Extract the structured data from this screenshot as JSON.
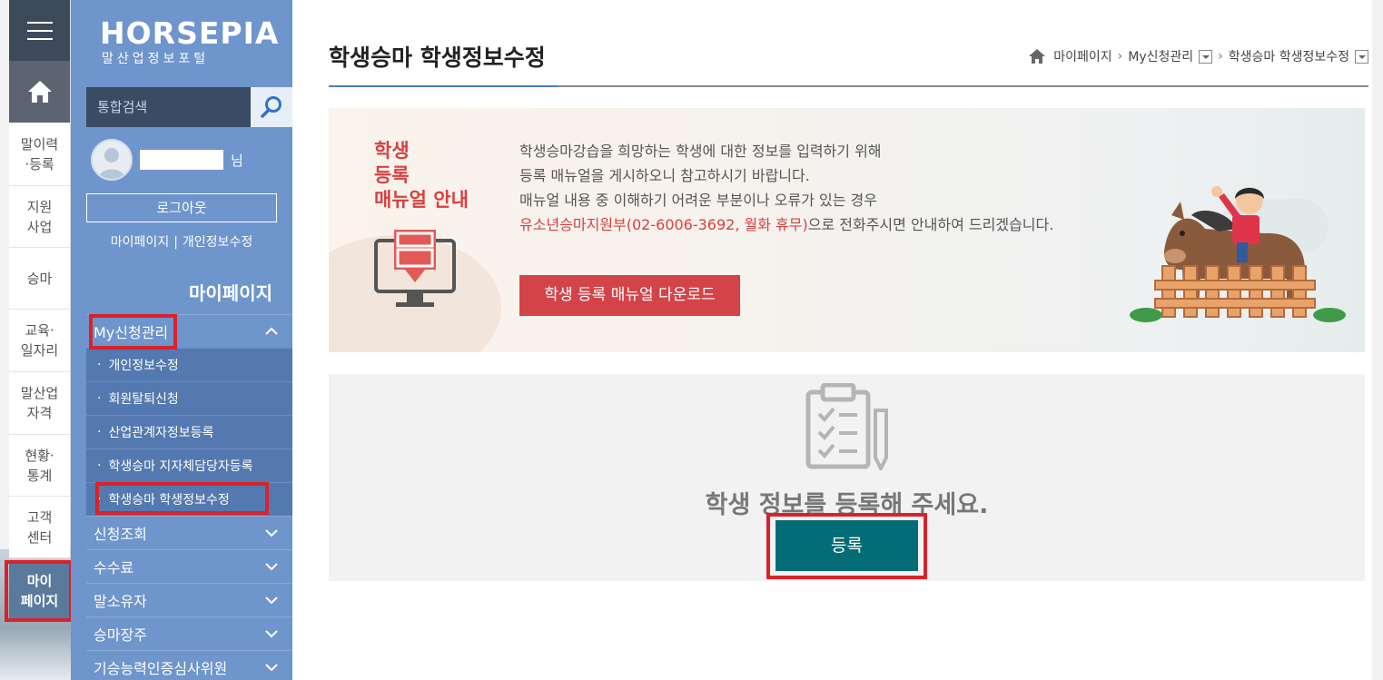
{
  "rail": {
    "items": [
      {
        "label": "말이력\n·등록"
      },
      {
        "label": "지원\n사업"
      },
      {
        "label": "승마"
      },
      {
        "label": "교육·\n일자리"
      },
      {
        "label": "말산업\n자격"
      },
      {
        "label": "현황·\n통계"
      },
      {
        "label": "고객\n센터"
      },
      {
        "label": "마이\n페이지"
      }
    ]
  },
  "brand": {
    "main": "HORSEPIA",
    "sub": "말산업정보포털"
  },
  "search": {
    "placeholder": "통합검색"
  },
  "user": {
    "suffix": "님"
  },
  "sidebar": {
    "logout": "로그아웃",
    "quick_links": [
      "마이페이지",
      "개인정보수정"
    ],
    "section_title": "마이페이지",
    "open_group": "My신청관리",
    "sub_items": [
      "개인정보수정",
      "회원탈퇴신청",
      "산업관계자정보등록",
      "학생승마 지자체담당자등록",
      "학생승마 학생정보수정"
    ],
    "groups": [
      "신청조회",
      "수수료",
      "말소유자",
      "승마장주",
      "기승능력인증심사위원"
    ]
  },
  "page": {
    "title": "학생승마 학생정보수정",
    "breadcrumb": [
      "마이페이지",
      "My신청관리",
      "학생승마 학생정보수정"
    ]
  },
  "banner": {
    "heading": "학생\n등록\n매뉴얼 안내",
    "line1": "학생승마강습을 희망하는 학생에 대한 정보를 입력하기 위해",
    "line2": "등록 매뉴얼을 게시하오니 참고하시기 바랍니다.",
    "line3": "매뉴얼 내용 중 이해하기 어려운 부분이나 오류가 있는 경우",
    "line4_red": "유소년승마지원부(02-6006-3692, 월화 휴무)",
    "line4_rest": "으로 전화주시면 안내하여 드리겠습니다.",
    "download_button": "학생 등록 매뉴얼 다운로드"
  },
  "empty": {
    "message": "학생 정보를 등록해 주세요.",
    "register_button": "등록"
  },
  "colors": {
    "accent_red": "#d9222a",
    "sidebar_blue": "#6e95cc",
    "teal": "#036d75"
  }
}
